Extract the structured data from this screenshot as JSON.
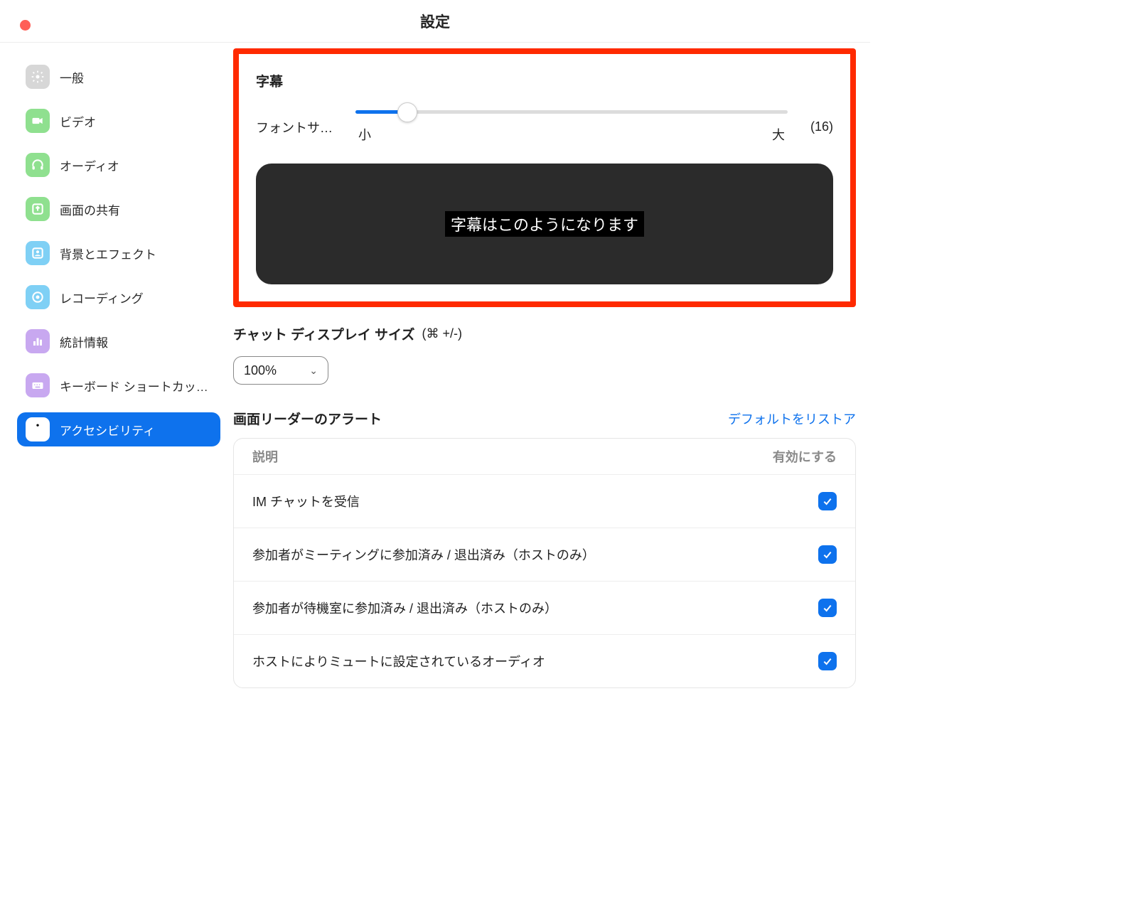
{
  "window": {
    "title": "設定"
  },
  "sidebar": {
    "items": [
      {
        "label": "一般",
        "icon": "gear",
        "bg": "#d7d7d7",
        "fg": "#fff"
      },
      {
        "label": "ビデオ",
        "icon": "video",
        "bg": "#8fe08f",
        "fg": "#fff"
      },
      {
        "label": "オーディオ",
        "icon": "headphones",
        "bg": "#8fe08f",
        "fg": "#fff"
      },
      {
        "label": "画面の共有",
        "icon": "share",
        "bg": "#8fe08f",
        "fg": "#fff"
      },
      {
        "label": "背景とエフェクト",
        "icon": "person",
        "bg": "#7fd0f5",
        "fg": "#fff"
      },
      {
        "label": "レコーディング",
        "icon": "record",
        "bg": "#7fd0f5",
        "fg": "#fff"
      },
      {
        "label": "統計情報",
        "icon": "stats",
        "bg": "#c8a8f0",
        "fg": "#fff"
      },
      {
        "label": "キーボード ショートカッ…",
        "icon": "keyboard",
        "bg": "#c8a8f0",
        "fg": "#fff"
      },
      {
        "label": "アクセシビリティ",
        "icon": "accessibility",
        "bg": "#fff",
        "fg": "#0e72ed",
        "active": true
      }
    ]
  },
  "captions": {
    "heading": "字幕",
    "font_size_label": "フォントサ…",
    "value_display": "(16)",
    "min_label": "小",
    "max_label": "大",
    "preview_text": "字幕はこのようになります"
  },
  "chat_display": {
    "label": "チャット ディスプレイ サイズ",
    "hint": "(⌘ +/-)",
    "value": "100%"
  },
  "alerts": {
    "heading": "画面リーダーのアラート",
    "restore_label": "デフォルトをリストア",
    "col_desc": "説明",
    "col_enable": "有効にする",
    "rows": [
      {
        "desc": "IM チャットを受信",
        "checked": true
      },
      {
        "desc": "参加者がミーティングに参加済み / 退出済み（ホストのみ）",
        "checked": true
      },
      {
        "desc": "参加者が待機室に参加済み / 退出済み（ホストのみ）",
        "checked": true
      },
      {
        "desc": "ホストによりミュートに設定されているオーディオ",
        "checked": true
      }
    ]
  }
}
